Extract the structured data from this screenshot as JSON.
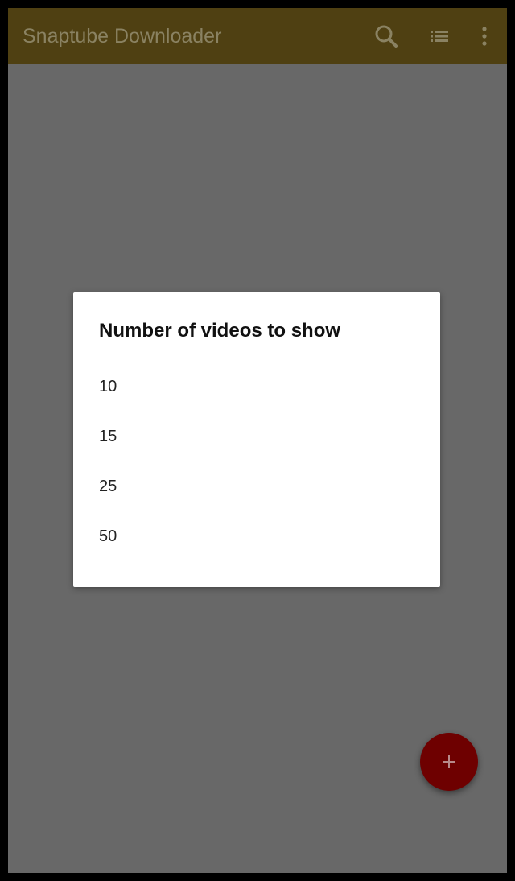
{
  "app_bar": {
    "title": "Snaptube Downloader",
    "icons": [
      "search-icon",
      "list-icon",
      "more-vert-icon"
    ],
    "color": "#4f4012"
  },
  "dialog": {
    "title": "Number of videos to show",
    "options": [
      {
        "label": "10"
      },
      {
        "label": "15"
      },
      {
        "label": "25"
      },
      {
        "label": "50"
      }
    ]
  },
  "fab": {
    "icon": "plus-icon",
    "color": "#6e0000"
  },
  "scrim_color": "#686868"
}
